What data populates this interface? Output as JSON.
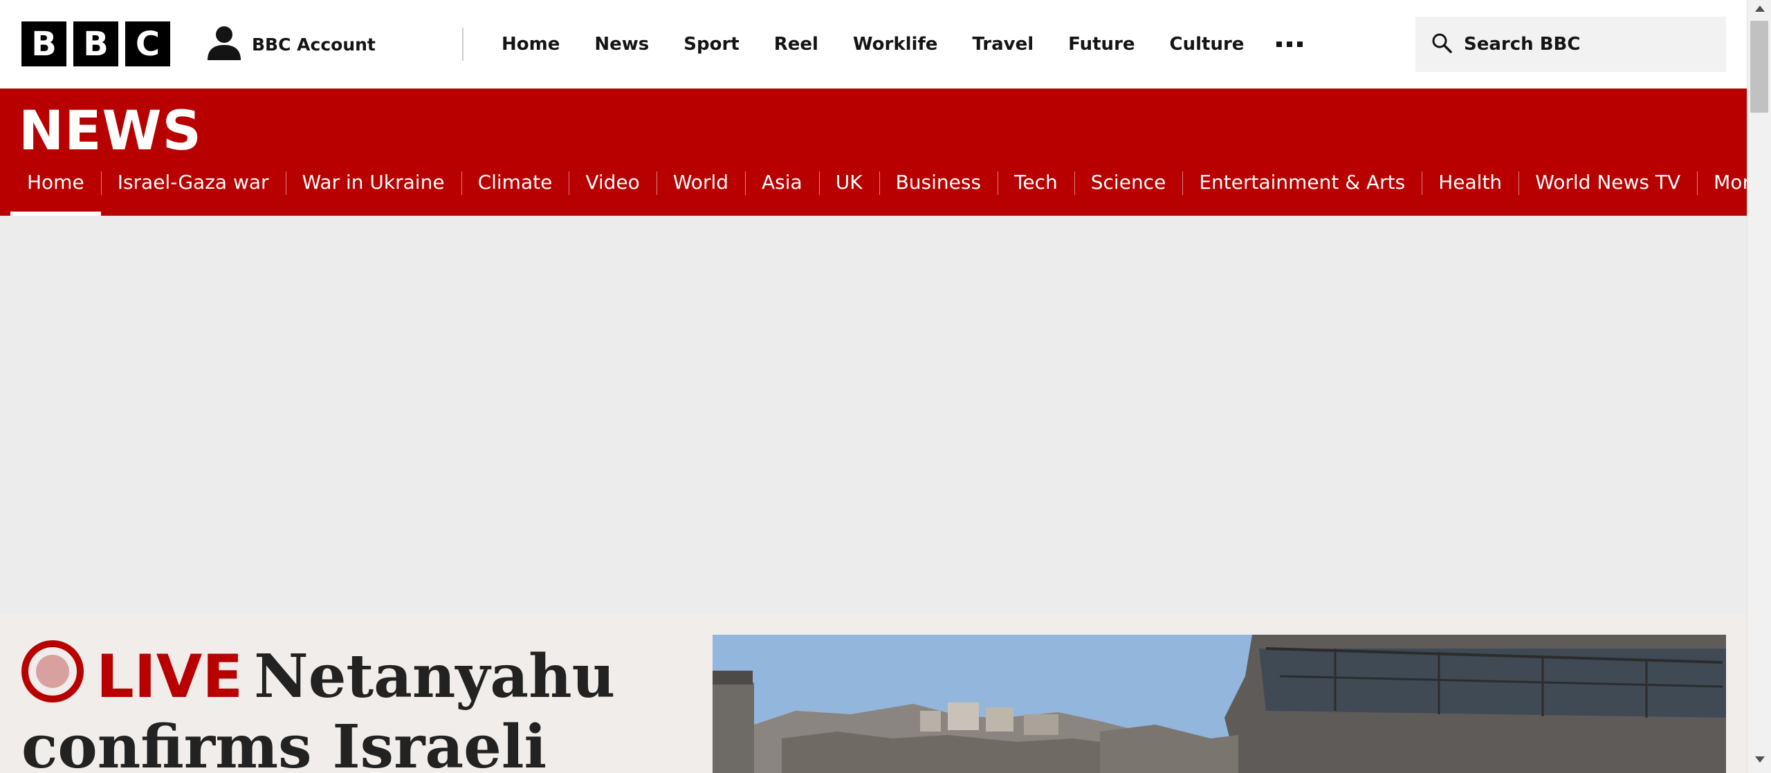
{
  "masthead": {
    "logo_letters": [
      "B",
      "B",
      "C"
    ],
    "account_label": "BBC Account",
    "nav": [
      "Home",
      "News",
      "Sport",
      "Reel",
      "Worklife",
      "Travel",
      "Future",
      "Culture"
    ],
    "more_icon": "ellipsis-icon",
    "search_placeholder": "Search BBC"
  },
  "news_band": {
    "title": "NEWS",
    "nav": [
      "Home",
      "Israel-Gaza war",
      "War in Ukraine",
      "Climate",
      "Video",
      "World",
      "Asia",
      "UK",
      "Business",
      "Tech",
      "Science",
      "Entertainment & Arts",
      "Health",
      "World News TV"
    ],
    "more_label": "More",
    "active_index": 0,
    "band_color": "#b80000"
  },
  "lead": {
    "live_label": "LIVE",
    "headline": "Netanyahu confirms Israeli"
  },
  "colors": {
    "brand_red": "#b80000",
    "ad_background": "#ececec",
    "lead_background": "#f0edea"
  }
}
